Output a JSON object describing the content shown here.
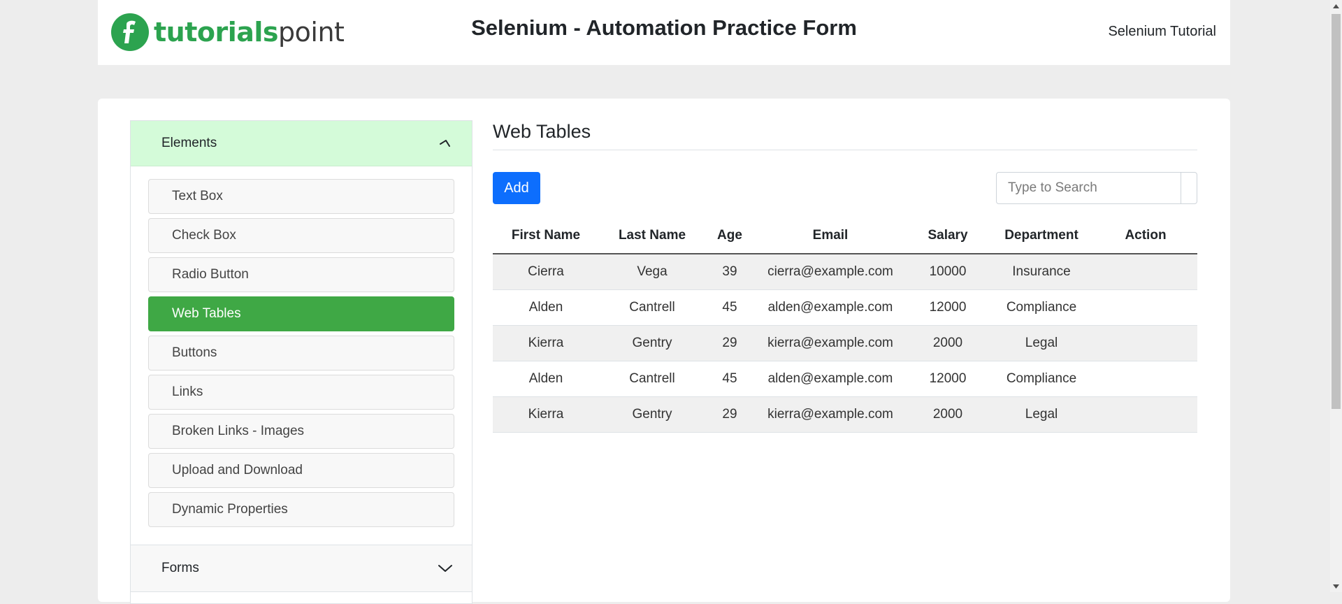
{
  "header": {
    "logo_part1": "tutorials",
    "logo_part2": "point",
    "title": "Selenium - Automation Practice Form",
    "link": "Selenium Tutorial"
  },
  "sidebar": {
    "group_label": "Elements",
    "items": [
      {
        "label": "Text Box",
        "active": false
      },
      {
        "label": "Check Box",
        "active": false
      },
      {
        "label": "Radio Button",
        "active": false
      },
      {
        "label": "Web Tables",
        "active": true
      },
      {
        "label": "Buttons",
        "active": false
      },
      {
        "label": "Links",
        "active": false
      },
      {
        "label": "Broken Links - Images",
        "active": false
      },
      {
        "label": "Upload and Download",
        "active": false
      },
      {
        "label": "Dynamic Properties",
        "active": false
      }
    ],
    "next_group_label": "Forms"
  },
  "main": {
    "title": "Web Tables",
    "add_label": "Add",
    "search_placeholder": "Type to Search",
    "columns": [
      "First Name",
      "Last Name",
      "Age",
      "Email",
      "Salary",
      "Department",
      "Action"
    ],
    "rows": [
      [
        "Cierra",
        "Vega",
        "39",
        "cierra@example.com",
        "10000",
        "Insurance",
        ""
      ],
      [
        "Alden",
        "Cantrell",
        "45",
        "alden@example.com",
        "12000",
        "Compliance",
        ""
      ],
      [
        "Kierra",
        "Gentry",
        "29",
        "kierra@example.com",
        "2000",
        "Legal",
        ""
      ],
      [
        "Alden",
        "Cantrell",
        "45",
        "alden@example.com",
        "12000",
        "Compliance",
        ""
      ],
      [
        "Kierra",
        "Gentry",
        "29",
        "kierra@example.com",
        "2000",
        "Legal",
        ""
      ]
    ]
  },
  "colors": {
    "accent_green": "#3fa845",
    "active_group_bg": "#d4fbd9",
    "primary_button": "#0d6efd",
    "logo_green": "#2ca34f"
  }
}
